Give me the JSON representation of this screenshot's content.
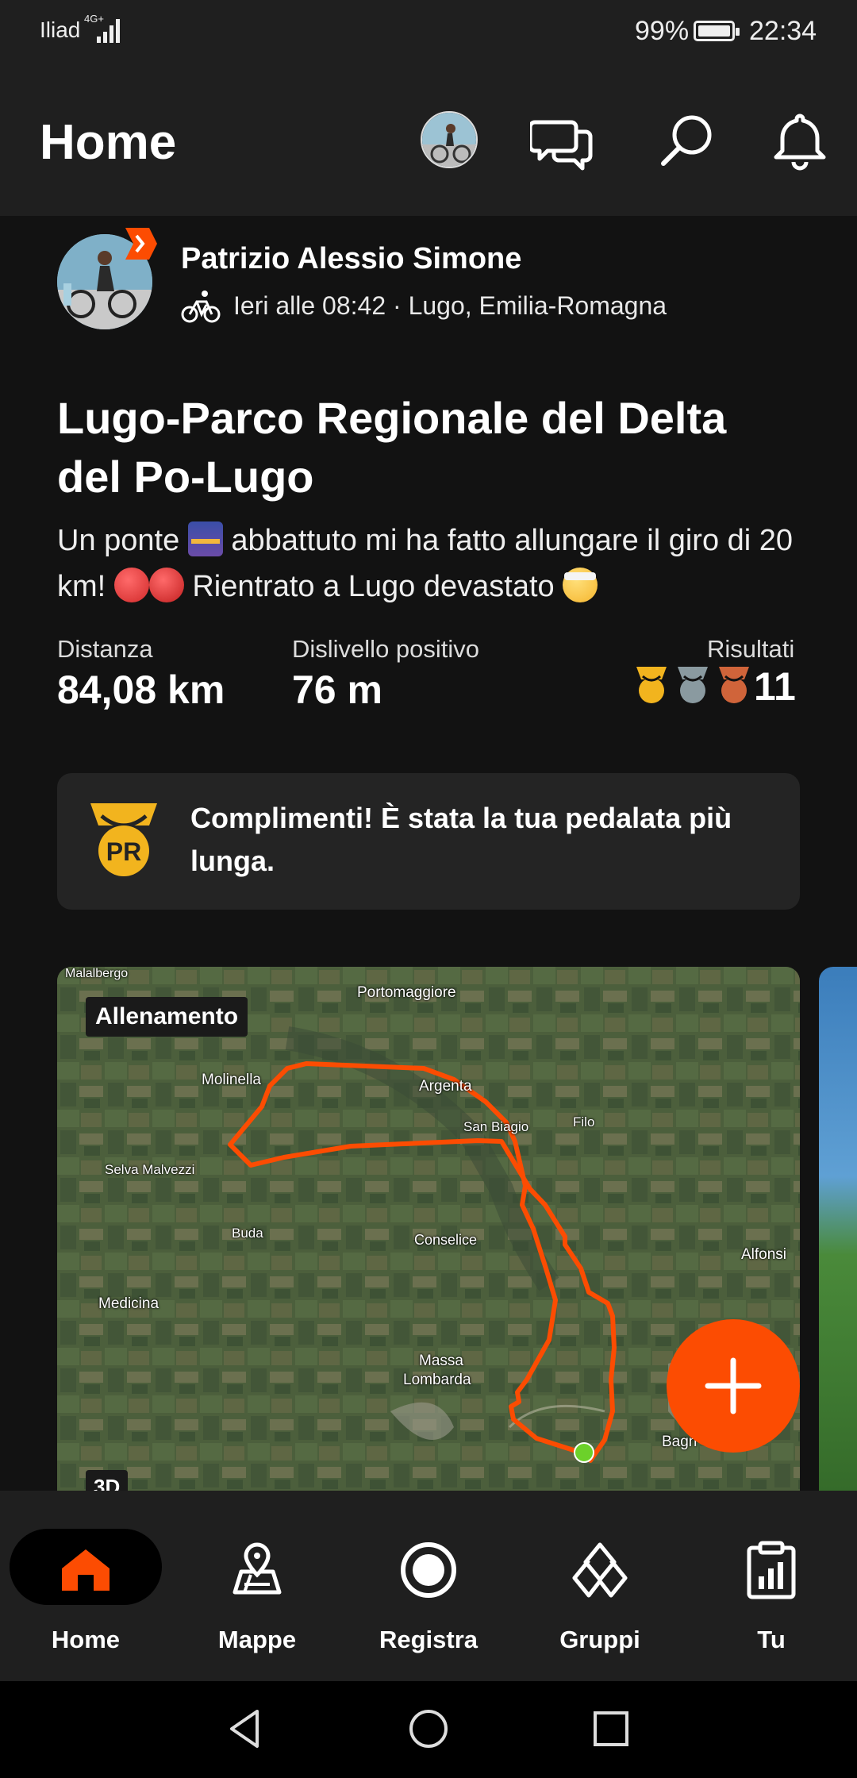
{
  "status_bar": {
    "carrier": "Iliad",
    "network": "4G+",
    "battery": "99%",
    "battery_level": 0.99,
    "time": "22:34"
  },
  "header": {
    "title": "Home"
  },
  "post": {
    "author": "Patrizio Alessio Simone",
    "meta": "Ieri alle 08:42 · Lugo, Emilia-Romagna",
    "title": "Lugo-Parco Regionale del Delta del Po-Lugo",
    "desc": {
      "part1": "Un ponte ",
      "part2": " abbattuto mi ha fatto allungare il giro di 20 km! ",
      "part3": " Rientrato a Lugo devastato "
    },
    "stats": {
      "distance_label": "Distanza",
      "distance_value": "84,08 km",
      "elevation_label": "Dislivello positivo",
      "elevation_value": "76 m",
      "results_label": "Risultati",
      "results_value": "11"
    },
    "achievement": {
      "badge": "PR",
      "text": "Complimenti! È stata la tua pedalata più lunga."
    },
    "map": {
      "chip": "Allenamento",
      "chip_3d": "3D",
      "towns": {
        "malalbergo": "Malalbergo",
        "portomaggiore": "Portomaggiore",
        "molinella": "Molinella",
        "argenta": "Argenta",
        "san_biagio": "San Biagio",
        "filo": "Filo",
        "selva": "Selva Malvezzi",
        "buda": "Buda",
        "conselice": "Conselice",
        "alfonsine": "Alfonsi",
        "medicina": "Medicina",
        "massa": "Massa",
        "lombarda": "Lombarda",
        "bagnacavallo": "Bagn   cavallo"
      }
    }
  },
  "bottom_nav": {
    "home": "Home",
    "maps": "Mappe",
    "record": "Registra",
    "groups": "Gruppi",
    "you": "Tu"
  },
  "colors": {
    "accent": "#fc4c02",
    "gold": "#f2b41e",
    "silver": "#8a9aa0",
    "bronze": "#d0643a"
  }
}
